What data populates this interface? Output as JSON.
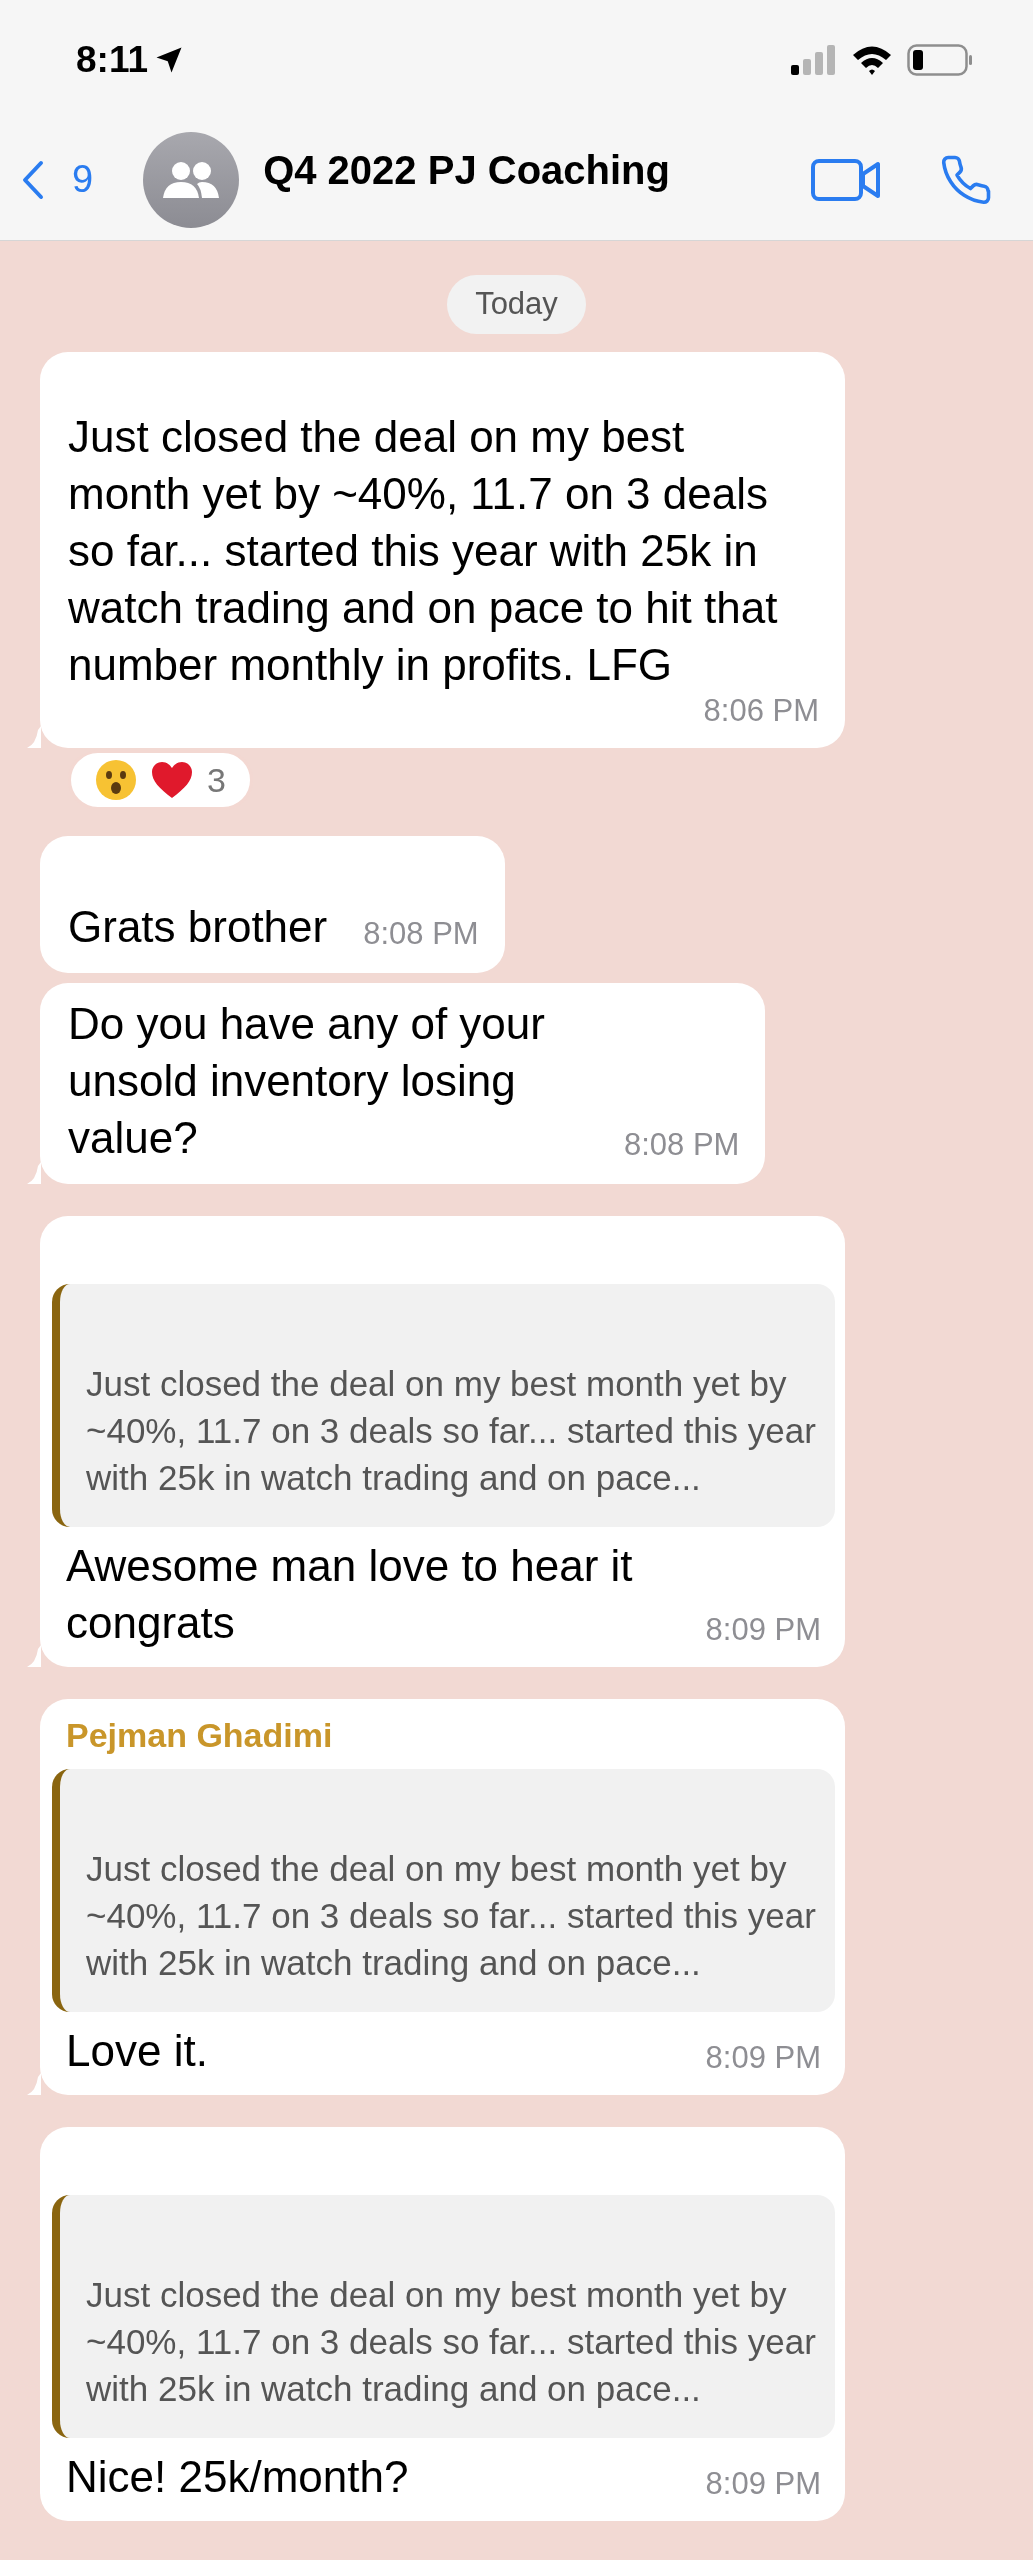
{
  "status_bar": {
    "time": "8:11"
  },
  "header": {
    "back_count": "9",
    "title": "Q4 2022 PJ Coaching"
  },
  "date_divider": "Today",
  "messages": [
    {
      "kind": "long_text",
      "tail": true,
      "text": "Just closed the deal on my best month yet by ~40%, 11.7 on 3 deals so far... started this year with 25k in watch trading and on pace to hit that number monthly in profits. LFG",
      "time": "8:06 PM",
      "reactions": {
        "count": "3"
      }
    },
    {
      "kind": "text",
      "tail": false,
      "text": "Grats brother",
      "time": "8:08 PM"
    },
    {
      "kind": "text",
      "tail": true,
      "text": "Do you have any of your unsold inventory losing value?",
      "time": "8:08 PM"
    },
    {
      "kind": "reply",
      "tail": true,
      "quote": "Just closed the deal on my best month yet by ~40%, 11.7 on 3 deals so far... started this year with 25k in watch trading and on pace...",
      "text": "Awesome man love to hear it congrats",
      "time": "8:09 PM"
    },
    {
      "kind": "reply",
      "tail": true,
      "sender": {
        "name": "Pejman Ghadimi",
        "color": "#c9962a"
      },
      "quote": "Just closed the deal on my best month yet by ~40%, 11.7 on 3 deals so far... started this year with 25k in watch trading and on pace...",
      "text": "Love it.",
      "time": "8:09 PM"
    },
    {
      "kind": "reply",
      "tail": false,
      "quote": "Just closed the deal on my best month yet by ~40%, 11.7 on 3 deals so far... started this year with 25k in watch trading and on pace...",
      "text": "Nice! 25k/month?",
      "time": "8:09 PM"
    }
  ]
}
